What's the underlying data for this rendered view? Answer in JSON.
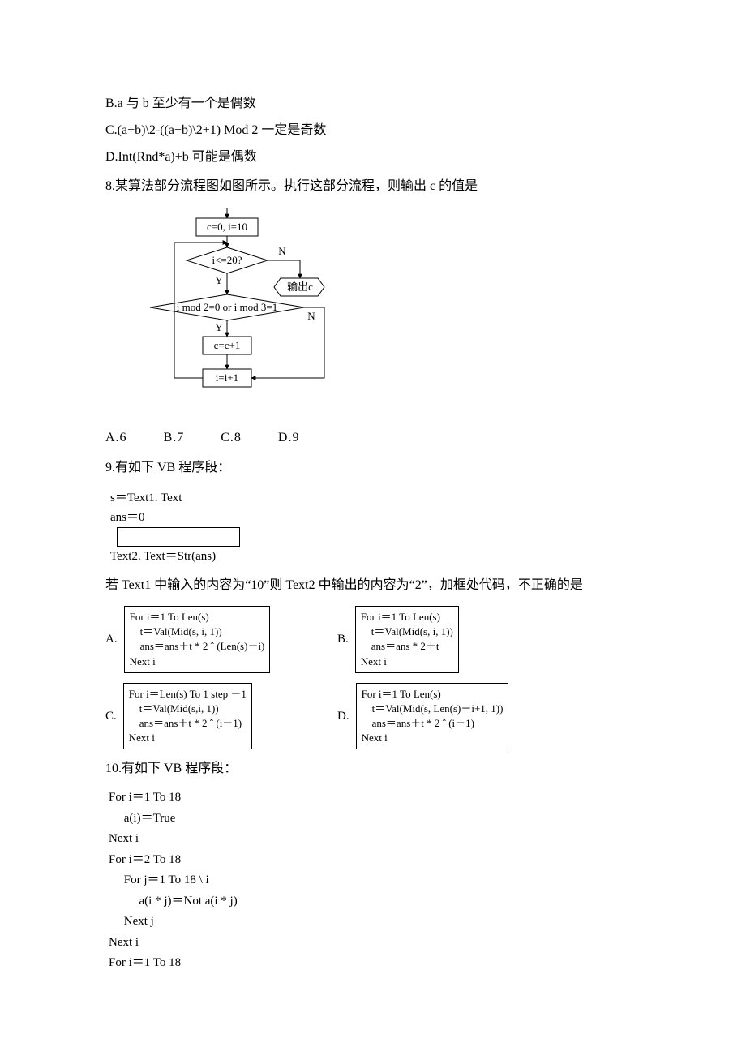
{
  "lines": {
    "optB": "B.a 与 b 至少有一个是偶数",
    "optC": "C.(a+b)\\2-((a+b)\\2+1) Mod 2 一定是奇数",
    "optD": "D.Int(Rnd*a)+b 可能是偶数",
    "q8": "8.某算法部分流程图如图所示。执行这部分流程，则输出 c 的值是"
  },
  "flow": {
    "init": "c=0, i=10",
    "cond1": "i<=20?",
    "cond2": "i mod 2=0 or i mod 3=1",
    "step": "c=c+1",
    "inc": "i=i+1",
    "out": "输出c",
    "Y": "Y",
    "N": "N"
  },
  "q8choices": {
    "a": "A.6",
    "b": "B.7",
    "c": "C.8",
    "d": "D.9"
  },
  "q9title": "9.有如下 VB 程序段：",
  "q9code": {
    "l1": "s＝Text1. Text",
    "l2": "ans＝0",
    "l3": "Text2. Text＝Str(ans)"
  },
  "q9stem": "若 Text1 中输入的内容为“10”则 Text2 中输出的内容为“2”，加框处代码，不正确的是",
  "q9opt": {
    "A": "For i＝1 To Len(s)\n    t＝Val(Mid(s, i, 1))\n    ans＝ans＋t * 2 ˆ (Len(s)－i)\nNext i",
    "B": "For i＝1 To Len(s)\n    t＝Val(Mid(s, i, 1))\n    ans＝ans * 2＋t\nNext i",
    "C": "For i＝Len(s) To 1 step －1\n    t＝Val(Mid(s,i, 1))\n    ans＝ans＋t * 2 ˆ (i－1)\nNext i",
    "D": "For i＝1 To Len(s)\n    t＝Val(Mid(s, Len(s)－i+1, 1))\n    ans＝ans＋t * 2 ˆ (i－1)\nNext i"
  },
  "labels": {
    "A": "A.",
    "B": "B.",
    "C": "C.",
    "D": "D."
  },
  "q10title": "10.有如下 VB 程序段：",
  "q10code": "For i＝1 To 18\n     a(i)＝True\nNext i\nFor i＝2 To 18\n     For j＝1 To 18 \\ i\n          a(i * j)＝Not a(i * j)\n     Next j\nNext i\nFor i＝1 To 18"
}
